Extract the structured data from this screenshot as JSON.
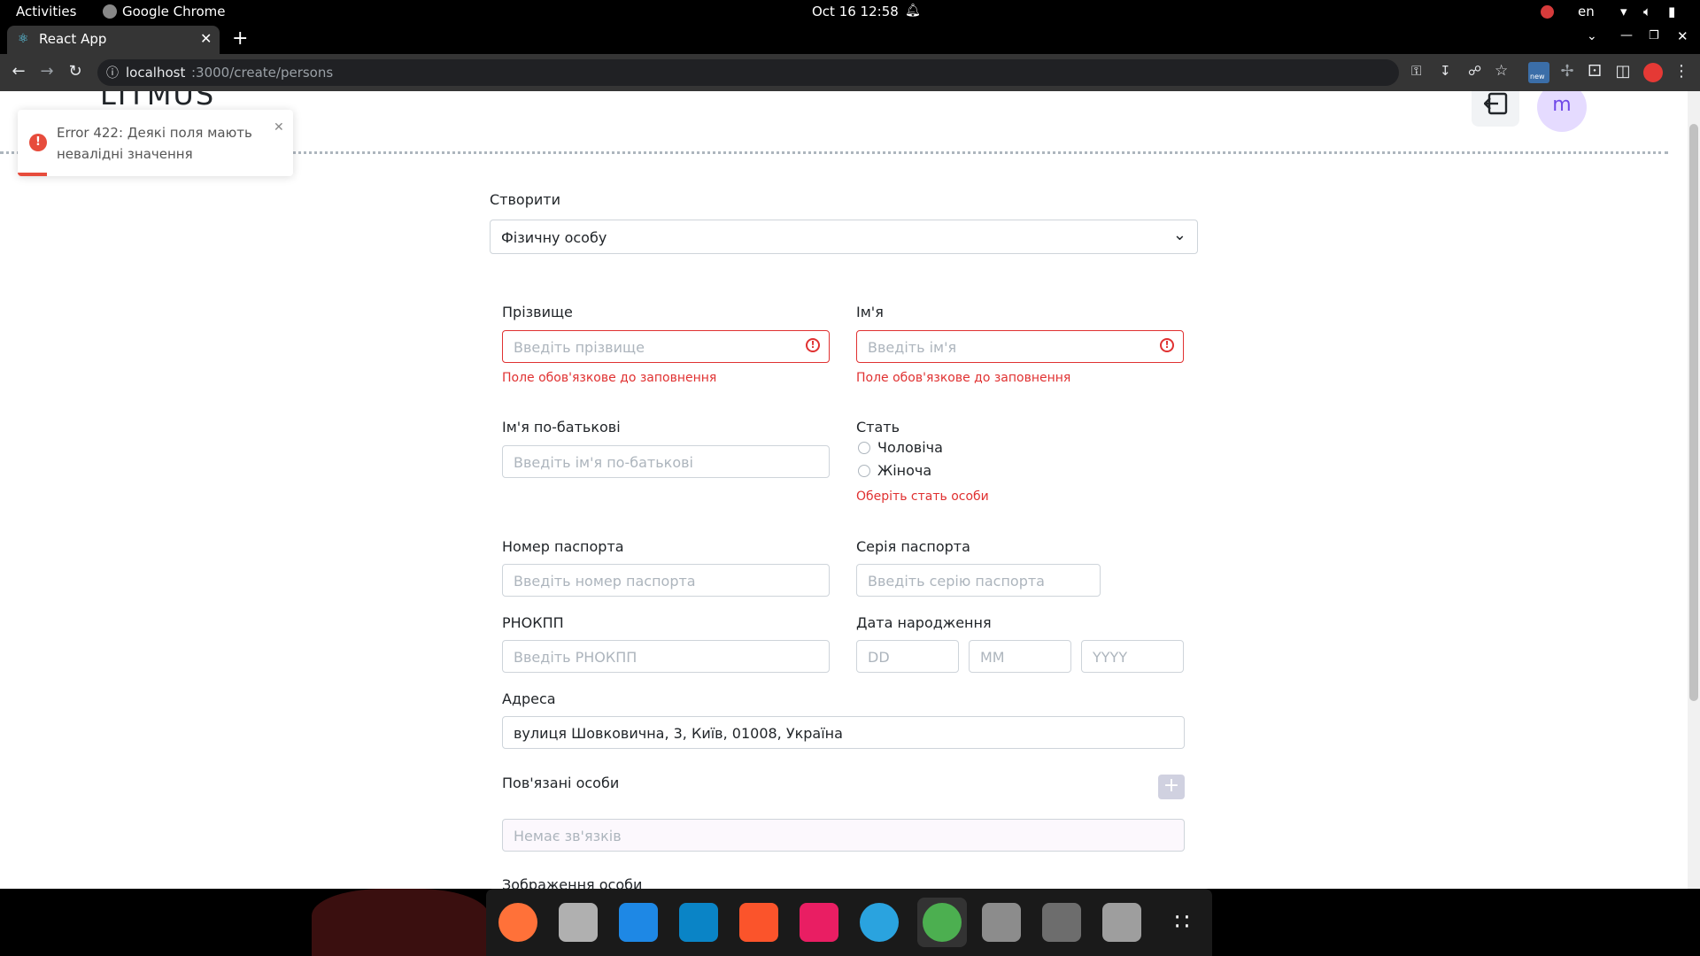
{
  "system_bar": {
    "activities": "Activities",
    "app_name": "Google Chrome",
    "clock": "Oct 16  12:58",
    "language": "en"
  },
  "browser": {
    "tab_title": "React App",
    "url_host": "localhost",
    "url_path": ":3000/create/persons",
    "ext_badge": "new"
  },
  "page": {
    "brand": "LITMUS",
    "avatar_letter": "m",
    "create_label": "Створити",
    "create_select_value": "Фізичну особу",
    "surname": {
      "label": "Прізвище",
      "placeholder": "Введіть прізвище",
      "error": "Поле обов'язкове до заповнення"
    },
    "name": {
      "label": "Ім'я",
      "placeholder": "Введіть ім'я",
      "error": "Поле обов'язкове до заповнення"
    },
    "patronymic": {
      "label": "Ім'я по-батькові",
      "placeholder": "Введіть ім'я по-батькові"
    },
    "gender": {
      "label": "Стать",
      "options": [
        "Чоловіча",
        "Жіноча"
      ],
      "error": "Оберіть стать особи"
    },
    "passport_number": {
      "label": "Номер паспорта",
      "placeholder": "Введіть номер паспорта"
    },
    "passport_series": {
      "label": "Серія паспорта",
      "placeholder": "Введіть серію паспорта"
    },
    "rnokpp": {
      "label": "РНОКПП",
      "placeholder": "Введіть РНОКПП"
    },
    "birth_date": {
      "label": "Дата народження",
      "day": "DD",
      "month": "MM",
      "year": "YYYY"
    },
    "address": {
      "label": "Адреса",
      "value": "вулиця Шовковична, 3, Київ, 01008, Україна"
    },
    "related": {
      "label": "Пов'язані особи",
      "placeholder": "Немає зв'язків"
    },
    "image_label": "Зображення особи"
  },
  "toast": {
    "message": "Error 422: Деякі поля мають невалідні значення"
  },
  "colors": {
    "error": "#e03131",
    "avatar_bg": "#e5dbff",
    "avatar_text": "#7048e8",
    "related_bg": "#fcf8fd"
  }
}
